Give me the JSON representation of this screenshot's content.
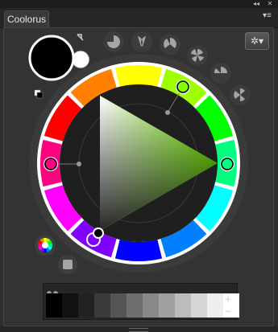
{
  "window": {
    "collapse_icon": "double-chevron-left-icon",
    "close_icon": "close-icon",
    "collapse_glyph": "◂◂",
    "close_glyph": "✕"
  },
  "tab": {
    "label": "Coolorus"
  },
  "panel_menu_glyph": "▾≡",
  "colors": {
    "foreground": "#000000",
    "background": "#ffffff",
    "selected_hue": "#7dff00",
    "panel_bg": "#333333"
  },
  "color_wheel": {
    "segments": [
      "#ffff00",
      "#9dff00",
      "#00ff00",
      "#00ff80",
      "#00ffff",
      "#0080ff",
      "#0000ff",
      "#8000ff",
      "#ff00ff",
      "#ff0080",
      "#ff0000",
      "#ff8000"
    ]
  },
  "gear_button": {
    "icon": "gear-icon",
    "glyph": "✲▾"
  },
  "palette": {
    "swatches": [
      "#000000",
      "#111111",
      "#222222",
      "#3a3a3a",
      "#555555",
      "#6e6e6e",
      "#888888",
      "#a0a0a0",
      "#bcbcbc",
      "#d5d5d5",
      "#eeeeee",
      "#ffffff"
    ],
    "add_label": "+",
    "remove_label": "−"
  }
}
